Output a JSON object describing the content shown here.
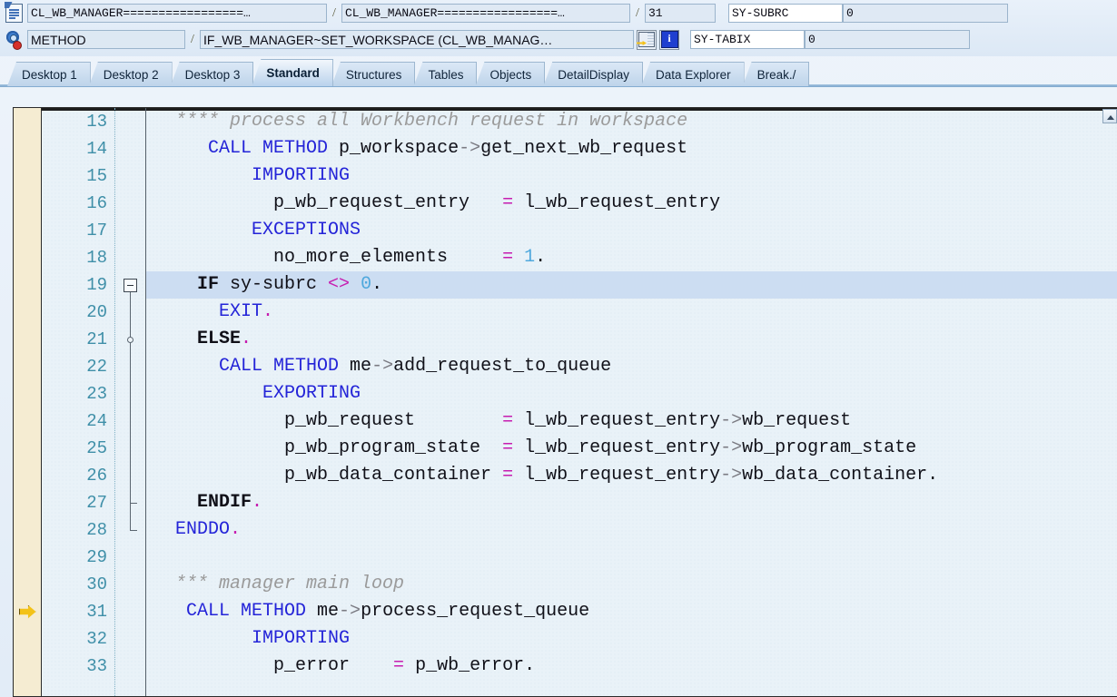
{
  "toolbar": {
    "program_icon": "document-list-icon",
    "event_icon": "gear-icon",
    "program_field": "CL_WB_MANAGER=================…",
    "include_field": "CL_WB_MANAGER=================…",
    "line_field": "31",
    "sy_subrc_label": "SY-SUBRC",
    "sy_subrc_value": "0",
    "event_type_field": "METHOD",
    "event_name_field": "IF_WB_MANAGER~SET_WORKSPACE (CL_WB_MANAG…",
    "goto_icon": "goto-source-icon",
    "info_icon": "information-icon",
    "sy_tabix_label": "SY-TABIX",
    "sy_tabix_value": "0",
    "separator": "/"
  },
  "tabs": [
    {
      "label": "Desktop 1",
      "active": false
    },
    {
      "label": "Desktop 2",
      "active": false
    },
    {
      "label": "Desktop 3",
      "active": false
    },
    {
      "label": "Standard",
      "active": true
    },
    {
      "label": "Structures",
      "active": false
    },
    {
      "label": "Tables",
      "active": false
    },
    {
      "label": "Objects",
      "active": false
    },
    {
      "label": "DetailDisplay",
      "active": false
    },
    {
      "label": "Data Explorer",
      "active": false
    },
    {
      "label": "Break./",
      "active": false
    }
  ],
  "editor": {
    "current_line": 31,
    "highlighted_line": 19,
    "current_line_marker": "execution-pointer-arrow",
    "lines": [
      {
        "n": "13",
        "tokens": [
          {
            "t": "cm",
            "s": "  **** process all Workbench request in workspace"
          }
        ]
      },
      {
        "n": "14",
        "tokens": [
          {
            "t": "k",
            "s": "     CALL METHOD "
          },
          {
            "t": "id",
            "s": "p_workspace"
          },
          {
            "t": "arw",
            "s": "->"
          },
          {
            "t": "id",
            "s": "get_next_wb_request"
          }
        ]
      },
      {
        "n": "15",
        "tokens": [
          {
            "t": "k",
            "s": "         IMPORTING"
          }
        ]
      },
      {
        "n": "16",
        "tokens": [
          {
            "t": "id",
            "s": "           p_wb_request_entry   "
          },
          {
            "t": "op",
            "s": "= "
          },
          {
            "t": "id",
            "s": "l_wb_request_entry"
          }
        ]
      },
      {
        "n": "17",
        "tokens": [
          {
            "t": "k",
            "s": "         EXCEPTIONS"
          }
        ]
      },
      {
        "n": "18",
        "tokens": [
          {
            "t": "id",
            "s": "           no_more_elements     "
          },
          {
            "t": "op",
            "s": "= "
          },
          {
            "t": "num-lit",
            "s": "1"
          },
          {
            "t": "id",
            "s": "."
          }
        ]
      },
      {
        "n": "19",
        "tokens": [
          {
            "t": "kb",
            "s": "    IF "
          },
          {
            "t": "id",
            "s": "sy-subrc "
          },
          {
            "t": "op",
            "s": "<> "
          },
          {
            "t": "num-lit",
            "s": "0"
          },
          {
            "t": "id",
            "s": "."
          }
        ]
      },
      {
        "n": "20",
        "tokens": [
          {
            "t": "k",
            "s": "      EXIT"
          },
          {
            "t": "op",
            "s": "."
          }
        ]
      },
      {
        "n": "21",
        "tokens": [
          {
            "t": "kb",
            "s": "    ELSE"
          },
          {
            "t": "op",
            "s": "."
          }
        ]
      },
      {
        "n": "22",
        "tokens": [
          {
            "t": "k",
            "s": "      CALL METHOD "
          },
          {
            "t": "id",
            "s": "me"
          },
          {
            "t": "arw",
            "s": "->"
          },
          {
            "t": "id",
            "s": "add_request_to_queue"
          }
        ]
      },
      {
        "n": "23",
        "tokens": [
          {
            "t": "k",
            "s": "          EXPORTING"
          }
        ]
      },
      {
        "n": "24",
        "tokens": [
          {
            "t": "id",
            "s": "            p_wb_request        "
          },
          {
            "t": "op",
            "s": "= "
          },
          {
            "t": "id",
            "s": "l_wb_request_entry"
          },
          {
            "t": "arw",
            "s": "->"
          },
          {
            "t": "id",
            "s": "wb_request"
          }
        ]
      },
      {
        "n": "25",
        "tokens": [
          {
            "t": "id",
            "s": "            p_wb_program_state  "
          },
          {
            "t": "op",
            "s": "= "
          },
          {
            "t": "id",
            "s": "l_wb_request_entry"
          },
          {
            "t": "arw",
            "s": "->"
          },
          {
            "t": "id",
            "s": "wb_program_state"
          }
        ]
      },
      {
        "n": "26",
        "tokens": [
          {
            "t": "id",
            "s": "            p_wb_data_container "
          },
          {
            "t": "op",
            "s": "= "
          },
          {
            "t": "id",
            "s": "l_wb_request_entry"
          },
          {
            "t": "arw",
            "s": "->"
          },
          {
            "t": "id",
            "s": "wb_data_container."
          }
        ]
      },
      {
        "n": "27",
        "tokens": [
          {
            "t": "kb",
            "s": "    ENDIF"
          },
          {
            "t": "op",
            "s": "."
          }
        ]
      },
      {
        "n": "28",
        "tokens": [
          {
            "t": "k",
            "s": "  ENDDO"
          },
          {
            "t": "op",
            "s": "."
          }
        ]
      },
      {
        "n": "29",
        "tokens": [
          {
            "t": "id",
            "s": ""
          }
        ]
      },
      {
        "n": "30",
        "tokens": [
          {
            "t": "cm",
            "s": "  *** manager main loop"
          }
        ]
      },
      {
        "n": "31",
        "tokens": [
          {
            "t": "k",
            "s": "   CALL METHOD "
          },
          {
            "t": "id",
            "s": "me"
          },
          {
            "t": "arw",
            "s": "->"
          },
          {
            "t": "id",
            "s": "process_request_queue"
          }
        ]
      },
      {
        "n": "32",
        "tokens": [
          {
            "t": "k",
            "s": "         IMPORTING"
          }
        ]
      },
      {
        "n": "33",
        "tokens": [
          {
            "t": "id",
            "s": "           p_error    "
          },
          {
            "t": "op",
            "s": "= "
          },
          {
            "t": "id",
            "s": "p_wb_error."
          }
        ]
      }
    ]
  },
  "colors": {
    "keyword": "#2424d8",
    "comment": "#9a9a9a",
    "operator": "#c61cb0",
    "literal": "#4fa8dd",
    "line_number": "#3f8fa8",
    "highlight_band": "#ccddf2",
    "marker_gutter": "#f5ecd2",
    "arrow": "#f3c218"
  }
}
